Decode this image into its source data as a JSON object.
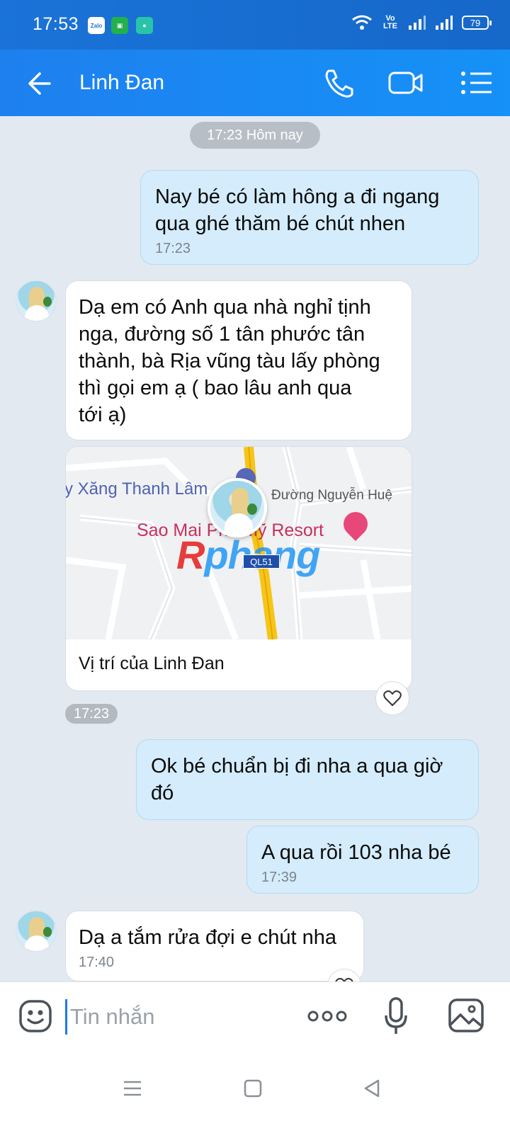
{
  "status_bar": {
    "time": "17:53",
    "app_icons": [
      "zalo-icon",
      "green-app-icon",
      "chat-app-icon"
    ],
    "zalo_label": "Zalo",
    "network_label": "Vo LTE",
    "battery": "79"
  },
  "header": {
    "contact_name": "Linh Đan",
    "icons": [
      "back-arrow-icon",
      "phone-icon",
      "video-call-icon",
      "menu-list-icon"
    ]
  },
  "chat": {
    "date_separator": "17:23 Hôm nay",
    "messages": [
      {
        "direction": "out",
        "text_line1": "Nay bé có làm hông a đi ngang",
        "text_line2": "qua ghé thăm bé chút nhen",
        "time": "17:23"
      },
      {
        "direction": "in",
        "lines": [
          "Dạ em có Anh qua nhà nghỉ tịnh",
          "nga, đường số 1 tân phước tân",
          "thành, bà Rịa vũng tàu lấy phòng",
          "thì gọi em ạ ( bao lâu anh qua",
          "tới ạ)"
        ]
      },
      {
        "direction": "in",
        "type": "location",
        "map_labels": {
          "gas_station": "y Xăng Thanh Lâm",
          "street": "Đường Nguyễn Huệ",
          "resort": "Sao Mai Phú Mỹ Resort",
          "road_badge": "QL51",
          "watermark_a": "R",
          "watermark_b": "phang"
        },
        "caption": "Vị trí của Linh Đan",
        "time": "17:23"
      },
      {
        "direction": "out",
        "text_line1": "Ok bé chuẩn bị đi nha a qua giờ",
        "text_line2": "đó"
      },
      {
        "direction": "out",
        "text": "A qua rồi 103 nha bé",
        "time": "17:39"
      },
      {
        "direction": "in",
        "text": "Dạ a tắm rửa đợi e chút nha",
        "time": "17:40"
      }
    ]
  },
  "input": {
    "placeholder": "Tin nhắn"
  },
  "colors": {
    "header": "#1e80ef",
    "outgoing_bubble": "#d4ecfb",
    "incoming_bubble": "#ffffff",
    "chat_background": "#e2e9f1"
  }
}
